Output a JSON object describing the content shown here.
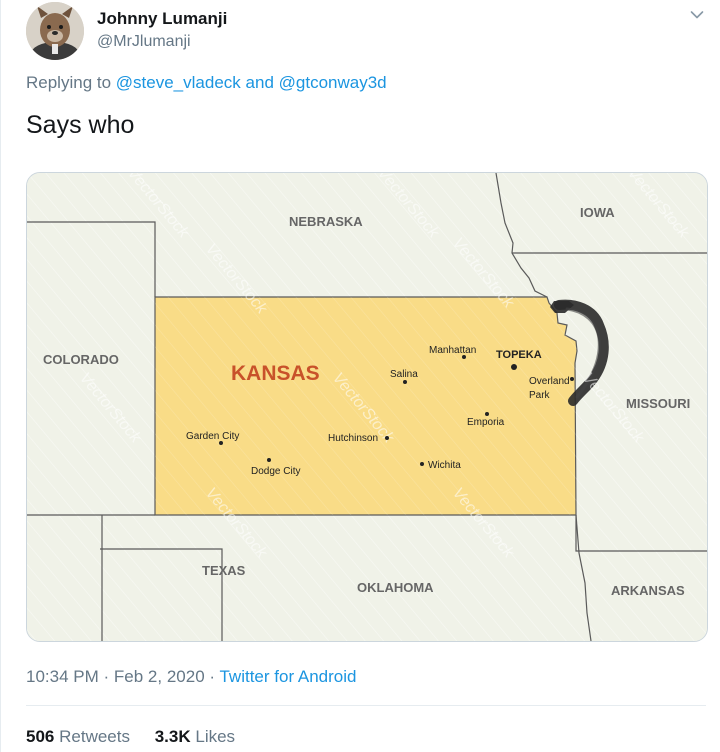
{
  "tweet": {
    "author_name": "Johnny Lumanji",
    "author_handle": "@MrJlumanji",
    "replying_prefix": "Replying to",
    "reply_mention_1": "@steve_vladeck",
    "reply_and": "and",
    "reply_mention_2": "@gtconway3d",
    "text": "Says who",
    "time": "10:34 PM",
    "date": "Feb 2, 2020",
    "source": "Twitter for Android",
    "retweets_count": "506",
    "retweets_label": "Retweets",
    "likes_count": "3.3K",
    "likes_label": "Likes",
    "menu_icon": "chevron-down-icon"
  },
  "map": {
    "state_label": "KANSAS",
    "neighbors": {
      "nebraska": "NEBRASKA",
      "iowa": "IOWA",
      "colorado": "COLORADO",
      "missouri": "MISSOURI",
      "texas": "TEXAS",
      "oklahoma": "OKLAHOMA",
      "arkansas": "ARKANSAS"
    },
    "cities": {
      "topeka": "TOPEKA",
      "manhattan": "Manhattan",
      "salina": "Salina",
      "overland_1": "Overland",
      "overland_2": "Park",
      "emporia": "Emporia",
      "garden_city": "Garden City",
      "hutchinson": "Hutchinson",
      "dodge_city": "Dodge City",
      "wichita": "Wichita"
    },
    "watermark": "VectorStock",
    "colors": {
      "state_fill": "#f9dc87",
      "state_label": "#c8522a",
      "land": "#f0f2e8",
      "border": "#5a5a5a",
      "scribble": "#2a2a2a"
    }
  }
}
